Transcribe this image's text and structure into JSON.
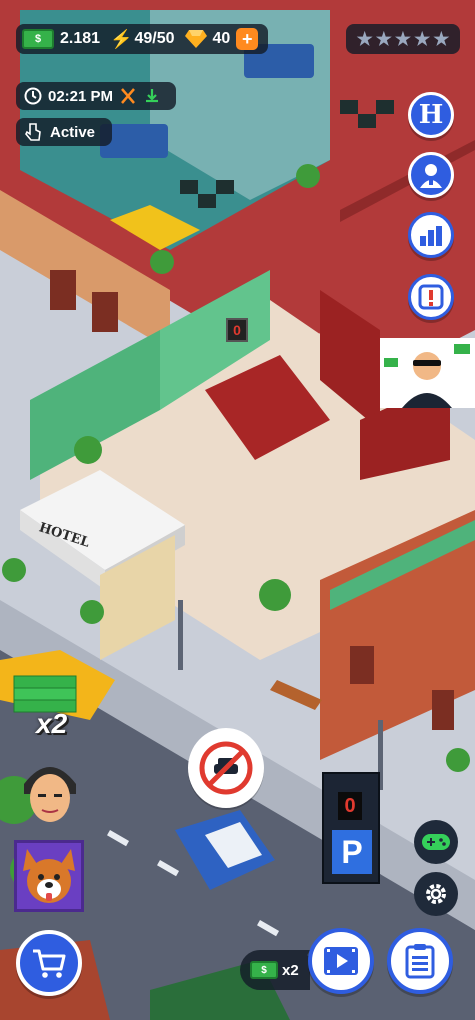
{
  "hud": {
    "cash": "2.181",
    "energy": "49/50",
    "gems": "40",
    "plus": "+",
    "stars_filled": 0,
    "stars_total": 5,
    "time": "02:21 PM",
    "status": "Active"
  },
  "side_menu": {
    "hotel_letter": "H"
  },
  "scene": {
    "hotel_sign": "HOTEL",
    "lobby_counter": "0",
    "parking_counter": "0",
    "parking_letter": "P",
    "income_multiplier": "x2"
  },
  "bottom": {
    "boost_label": "x2"
  },
  "colors": {
    "accent_blue": "#2f5de0",
    "hud_dark": "#141c28",
    "cash_green": "#35b24a",
    "energy_orange": "#ff7a1a",
    "wall_red": "#b23a3a",
    "floor_teal": "#3a8f8f"
  },
  "icons": {
    "cash": "cash-icon",
    "energy": "bolt-icon",
    "gem": "gem-icon",
    "clock": "clock-icon",
    "utensils": "utensils-icon",
    "download": "download-icon",
    "hand": "hand-pointer-icon",
    "hotel": "hotel-icon",
    "manager": "manager-icon",
    "stats": "bar-chart-icon",
    "alert": "alert-icon",
    "gamepad": "gamepad-icon",
    "settings": "gear-icon",
    "shop": "cart-icon",
    "video": "video-icon",
    "tasks": "clipboard-icon",
    "no_car": "no-car-icon"
  }
}
